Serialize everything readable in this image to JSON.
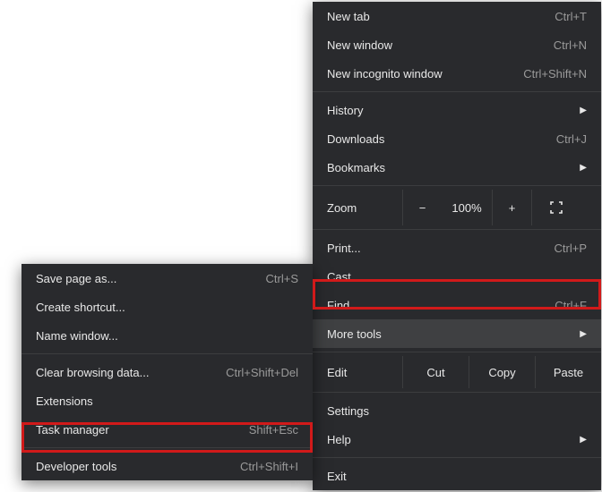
{
  "mainMenu": {
    "newTab": {
      "label": "New tab",
      "shortcut": "Ctrl+T"
    },
    "newWindow": {
      "label": "New window",
      "shortcut": "Ctrl+N"
    },
    "newIncognito": {
      "label": "New incognito window",
      "shortcut": "Ctrl+Shift+N"
    },
    "history": {
      "label": "History"
    },
    "downloads": {
      "label": "Downloads",
      "shortcut": "Ctrl+J"
    },
    "bookmarks": {
      "label": "Bookmarks"
    },
    "zoom": {
      "label": "Zoom",
      "out": "−",
      "pct": "100%",
      "in": "+"
    },
    "print": {
      "label": "Print...",
      "shortcut": "Ctrl+P"
    },
    "cast": {
      "label": "Cast..."
    },
    "find": {
      "label": "Find...",
      "shortcut": "Ctrl+F"
    },
    "moreTools": {
      "label": "More tools"
    },
    "edit": {
      "label": "Edit",
      "cut": "Cut",
      "copy": "Copy",
      "paste": "Paste"
    },
    "settings": {
      "label": "Settings"
    },
    "help": {
      "label": "Help"
    },
    "exit": {
      "label": "Exit"
    }
  },
  "subMenu": {
    "savePageAs": {
      "label": "Save page as...",
      "shortcut": "Ctrl+S"
    },
    "createShortcut": {
      "label": "Create shortcut..."
    },
    "nameWindow": {
      "label": "Name window..."
    },
    "clearBrowsing": {
      "label": "Clear browsing data...",
      "shortcut": "Ctrl+Shift+Del"
    },
    "extensions": {
      "label": "Extensions"
    },
    "taskManager": {
      "label": "Task manager",
      "shortcut": "Shift+Esc"
    },
    "devTools": {
      "label": "Developer tools",
      "shortcut": "Ctrl+Shift+I"
    }
  }
}
